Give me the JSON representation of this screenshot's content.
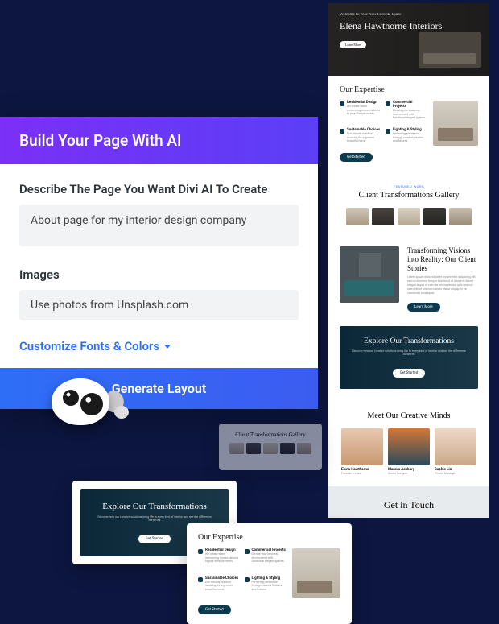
{
  "panel": {
    "title": "Build Your Page With AI",
    "describe_label": "Describe The Page You Want Divi AI To Create",
    "describe_value": "About page for my interior design company",
    "images_label": "Images",
    "images_value": "Use photos from Unsplash.com",
    "customize_label": "Customize Fonts & Colors",
    "generate_label": "Generate Layout"
  },
  "preview": {
    "hero_subtitle": "Welcome to Your New Favorite Space",
    "hero_title": "Elena Hawthorne Interiors",
    "hero_button": "Learn More",
    "expertise_title": "Our Expertise",
    "expertise_items": [
      {
        "title": "Residential Design",
        "body": "We create warm welcoming homes tailored to your lifestyle needs."
      },
      {
        "title": "Commercial Projects",
        "body": "Elevate your business environment with functional elegant spaces."
      },
      {
        "title": "Sustainable Choices",
        "body": "Eco-friendly material sourcing for a greener beautiful home."
      },
      {
        "title": "Lighting & Styling",
        "body": "Perfecting ambience through curated finishes and fixtures."
      }
    ],
    "expertise_button": "Get Started",
    "gallery_subtitle": "FEATURED WORK",
    "gallery_title": "Client Transformations Gallery",
    "story_title": "Transforming Visions into Reality: Our Client Stories",
    "story_body": "Lorem ipsum dolor sit amet consectetur adipiscing elit sed do eiusmod tempor incididunt ut labore et dolore magna aliqua ut enim ad minim veniam quis nostrud exercitation ullamco laboris nisi ut aliquip ex ea commodo consequat.",
    "story_button": "Learn More",
    "explore_title": "Explore Our Transformations",
    "explore_sub": "Discover how our creative solutions bring life to every kind of interior and see the difference ourselves",
    "explore_button": "Get Started",
    "team_title": "Meet Our Creative Minds",
    "team": [
      {
        "name": "Elena Hawthorne",
        "role": "Founder & Lead"
      },
      {
        "name": "Marcus Ashbury",
        "role": "Senior Designer"
      },
      {
        "name": "Sophie Lin",
        "role": "Project Manager"
      }
    ],
    "touch_title": "Get in Touch"
  }
}
